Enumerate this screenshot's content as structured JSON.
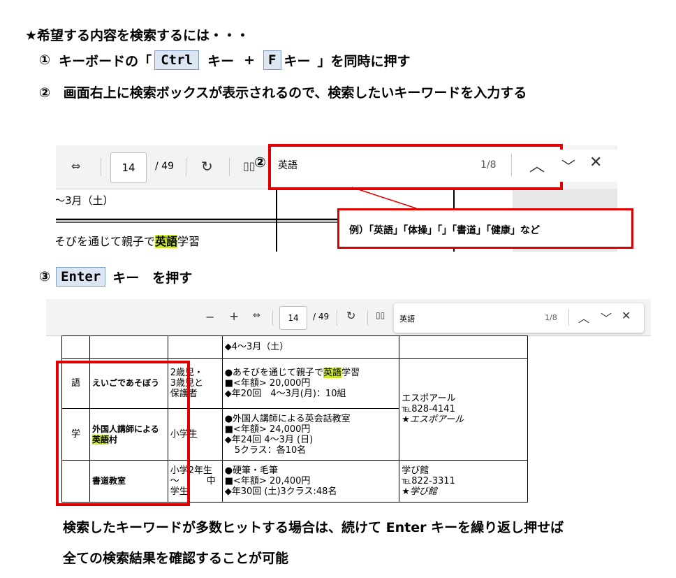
{
  "heading": "★希望する内容を検索するには・・・",
  "step1": {
    "num": "①",
    "pre": "キーボードの「",
    "key1": "Ctrl",
    "mid1": "キー",
    "plus": "+",
    "key2": "F",
    "mid2": "キー",
    "post": "」を同時に押す"
  },
  "step2": {
    "num": "②",
    "text": "画面右上に検索ボックスが表示されるので、検索したいキーワードを入力する"
  },
  "shot1": {
    "page_current": "14",
    "page_total": "/ 49",
    "marker": "②",
    "search_value": "英語",
    "search_count": "1/8",
    "row1": "～3月（土）",
    "row2_pre": "そびを通じて親子で",
    "row2_hl": "英語",
    "row2_post": "学習",
    "callout": "例）「英語」「体操」「」「書道」「健康」など"
  },
  "step3": {
    "num": "③",
    "key": "Enter",
    "text": "キー　を押す"
  },
  "shot2": {
    "minus": "−",
    "plus": "+",
    "page_current": "14",
    "page_total": "/ 49",
    "search_value": "英語",
    "search_count": "1/8",
    "top_row": "◆4～3月（土）",
    "cat1": "語",
    "cat2": "学",
    "r1": {
      "name": "えいごであそぼう",
      "target": [
        "2歳児・",
        "3歳児と",
        "保護者"
      ],
      "d1_pre": "●あそびを通じて親子で",
      "d1_hl": "英語",
      "d1_post": "学習",
      "d2": "■<年額> 20,000円",
      "d3": "◆年20回　4～3月(月)：10組"
    },
    "r2": {
      "name_a": "外国人講師による",
      "name_b_hl": "英語",
      "name_b_post": "村",
      "target": "小学生",
      "d1": "●外国人講師による英会話教室",
      "d2": "■<年額> 24,000円",
      "d3": "◆年24回 4～3月 (日)",
      "d4": "5クラス：各10名"
    },
    "venue1": [
      "エスポアール",
      "℡828-4141",
      "★エスポアール"
    ],
    "r3": {
      "name": "書道教室",
      "target_a": "小学2年生",
      "target_b": "～　　　中",
      "target_c": "学生",
      "d1": "●硬筆・毛筆",
      "d2": "■<年額> 20,400円",
      "d3": "◆年30回 (土)3クラス:48名",
      "venue": [
        "学び館",
        "℡822-3311",
        "★学び館"
      ]
    }
  },
  "footer": {
    "line1": "検索したキーワードが多数ヒットする場合は、続けて Enter キーを繰り返し押せば",
    "line2": "全ての検索結果を確認することが可能"
  },
  "colors": {
    "accent_red": "#e00000",
    "key_bg": "#dce6f2",
    "highlight": "#c9e62c"
  }
}
